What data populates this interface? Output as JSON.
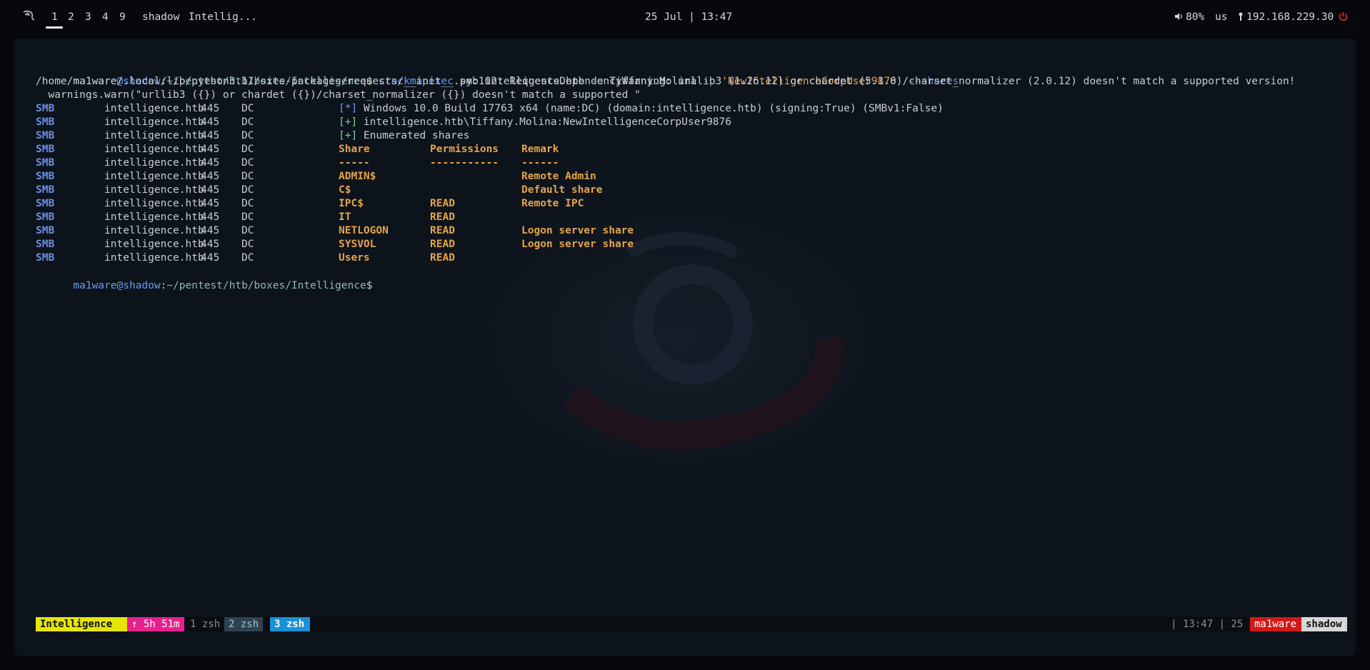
{
  "topbar": {
    "workspaces": [
      "1",
      "2",
      "3",
      "4",
      "9"
    ],
    "active_workspace": "1",
    "hostname": "shadow",
    "window_title": "Intellig...",
    "datetime": "25 Jul | 13:47",
    "volume": "80%",
    "keyboard_layout": "us",
    "ip": "192.168.229.30",
    "icons": [
      "kali-dragon-icon",
      "volume-icon",
      "network-icon",
      "power-icon"
    ],
    "colors": {
      "power": "#e0303a",
      "background": "#06080b"
    }
  },
  "terminal": {
    "prompt": {
      "user_host": "ma1ware@shadow",
      "sep": ":",
      "path": "~/pentest/htb/boxes/Intelligence",
      "symbol": "$"
    },
    "command": {
      "program": "crackmapexec",
      "args1": " smb intelligence.htb ",
      "flag_u": "-u",
      "user": " Tiffany.Molina ",
      "flag_p": "-p",
      "password": " 'NewIntelligenceCorpUser9876'",
      "shares_flag": " --shares"
    },
    "warning_line1": "/home/ma1ware/.local/lib/python3.11/site-packages/requests/__init__.py:102: RequestsDependencyWarning: urllib3 (1.26.12) or chardet (5.1.0)/charset_normalizer (2.0.12) doesn't match a supported version!",
    "warning_line2": "  warnings.warn(\"urllib3 ({}) or chardet ({})/charset_normalizer ({}) doesn't match a supported \"",
    "smb_rows": [
      {
        "proto": "SMB",
        "host": "intelligence.htb",
        "port": "445",
        "name": "DC",
        "tag": "[*]",
        "tag_type": "info",
        "msg": " Windows 10.0 Build 17763 x64 (name:DC) (domain:intelligence.htb) (signing:True) (SMBv1:False)"
      },
      {
        "proto": "SMB",
        "host": "intelligence.htb",
        "port": "445",
        "name": "DC",
        "tag": "[+]",
        "tag_type": "ok",
        "msg": " intelligence.htb\\Tiffany.Molina:NewIntelligenceCorpUser9876"
      },
      {
        "proto": "SMB",
        "host": "intelligence.htb",
        "port": "445",
        "name": "DC",
        "tag": "[+]",
        "tag_type": "ok",
        "msg": " Enumerated shares"
      }
    ],
    "share_table": {
      "header": {
        "share": "Share",
        "perm": "Permissions",
        "remark": "Remark"
      },
      "divider": {
        "share": "-----",
        "perm": "-----------",
        "remark": "------"
      },
      "rows": [
        {
          "share": "ADMIN$",
          "perm": "",
          "remark": "Remote Admin"
        },
        {
          "share": "C$",
          "perm": "",
          "remark": "Default share"
        },
        {
          "share": "IPC$",
          "perm": "READ",
          "remark": "Remote IPC"
        },
        {
          "share": "IT",
          "perm": "READ",
          "remark": ""
        },
        {
          "share": "NETLOGON",
          "perm": "READ",
          "remark": "Logon server share"
        },
        {
          "share": "SYSVOL",
          "perm": "READ",
          "remark": "Logon server share"
        },
        {
          "share": "Users",
          "perm": "READ",
          "remark": ""
        }
      ],
      "proto": "SMB",
      "host": "intelligence.htb",
      "port": "445",
      "name": "DC"
    }
  },
  "tmux": {
    "session_icon": "",
    "session": "Intelligence",
    "uptime": "↑ 5h 51m",
    "windows": [
      "1 zsh",
      "2 zsh",
      "3 zsh"
    ],
    "clock": "| 13:47 | 25 Jul",
    "user": "ma1ware",
    "host": "shadow"
  }
}
